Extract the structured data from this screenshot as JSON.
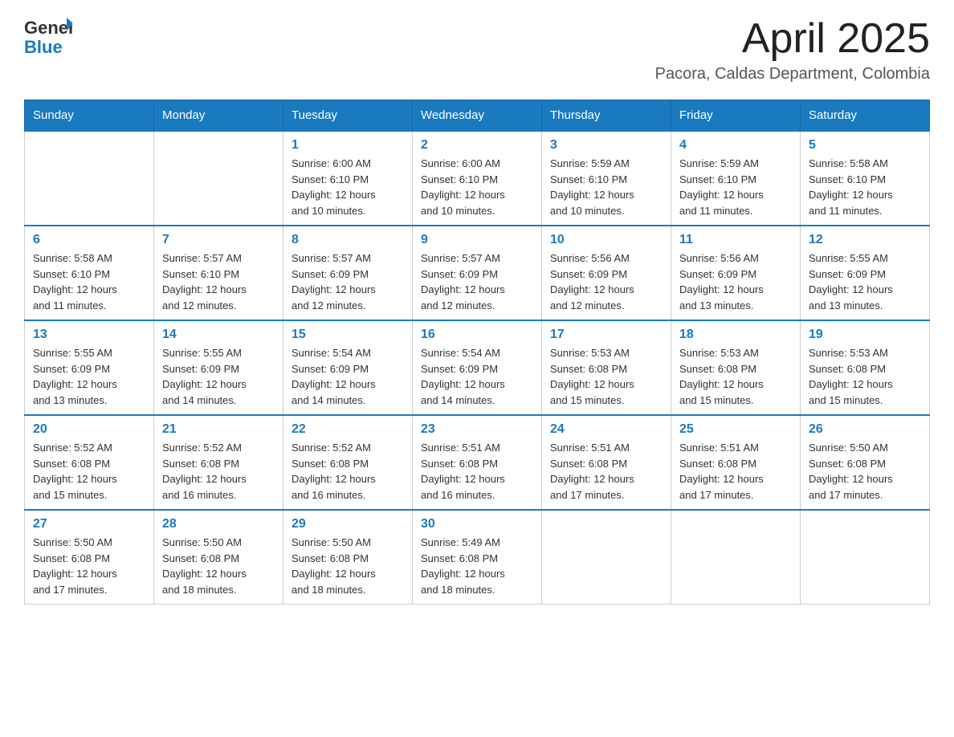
{
  "header": {
    "logo_general": "General",
    "logo_blue": "Blue",
    "month_title": "April 2025",
    "location": "Pacora, Caldas Department, Colombia"
  },
  "weekdays": [
    "Sunday",
    "Monday",
    "Tuesday",
    "Wednesday",
    "Thursday",
    "Friday",
    "Saturday"
  ],
  "weeks": [
    [
      {
        "day": "",
        "info": ""
      },
      {
        "day": "",
        "info": ""
      },
      {
        "day": "1",
        "info": "Sunrise: 6:00 AM\nSunset: 6:10 PM\nDaylight: 12 hours\nand 10 minutes."
      },
      {
        "day": "2",
        "info": "Sunrise: 6:00 AM\nSunset: 6:10 PM\nDaylight: 12 hours\nand 10 minutes."
      },
      {
        "day": "3",
        "info": "Sunrise: 5:59 AM\nSunset: 6:10 PM\nDaylight: 12 hours\nand 10 minutes."
      },
      {
        "day": "4",
        "info": "Sunrise: 5:59 AM\nSunset: 6:10 PM\nDaylight: 12 hours\nand 11 minutes."
      },
      {
        "day": "5",
        "info": "Sunrise: 5:58 AM\nSunset: 6:10 PM\nDaylight: 12 hours\nand 11 minutes."
      }
    ],
    [
      {
        "day": "6",
        "info": "Sunrise: 5:58 AM\nSunset: 6:10 PM\nDaylight: 12 hours\nand 11 minutes."
      },
      {
        "day": "7",
        "info": "Sunrise: 5:57 AM\nSunset: 6:10 PM\nDaylight: 12 hours\nand 12 minutes."
      },
      {
        "day": "8",
        "info": "Sunrise: 5:57 AM\nSunset: 6:09 PM\nDaylight: 12 hours\nand 12 minutes."
      },
      {
        "day": "9",
        "info": "Sunrise: 5:57 AM\nSunset: 6:09 PM\nDaylight: 12 hours\nand 12 minutes."
      },
      {
        "day": "10",
        "info": "Sunrise: 5:56 AM\nSunset: 6:09 PM\nDaylight: 12 hours\nand 12 minutes."
      },
      {
        "day": "11",
        "info": "Sunrise: 5:56 AM\nSunset: 6:09 PM\nDaylight: 12 hours\nand 13 minutes."
      },
      {
        "day": "12",
        "info": "Sunrise: 5:55 AM\nSunset: 6:09 PM\nDaylight: 12 hours\nand 13 minutes."
      }
    ],
    [
      {
        "day": "13",
        "info": "Sunrise: 5:55 AM\nSunset: 6:09 PM\nDaylight: 12 hours\nand 13 minutes."
      },
      {
        "day": "14",
        "info": "Sunrise: 5:55 AM\nSunset: 6:09 PM\nDaylight: 12 hours\nand 14 minutes."
      },
      {
        "day": "15",
        "info": "Sunrise: 5:54 AM\nSunset: 6:09 PM\nDaylight: 12 hours\nand 14 minutes."
      },
      {
        "day": "16",
        "info": "Sunrise: 5:54 AM\nSunset: 6:09 PM\nDaylight: 12 hours\nand 14 minutes."
      },
      {
        "day": "17",
        "info": "Sunrise: 5:53 AM\nSunset: 6:08 PM\nDaylight: 12 hours\nand 15 minutes."
      },
      {
        "day": "18",
        "info": "Sunrise: 5:53 AM\nSunset: 6:08 PM\nDaylight: 12 hours\nand 15 minutes."
      },
      {
        "day": "19",
        "info": "Sunrise: 5:53 AM\nSunset: 6:08 PM\nDaylight: 12 hours\nand 15 minutes."
      }
    ],
    [
      {
        "day": "20",
        "info": "Sunrise: 5:52 AM\nSunset: 6:08 PM\nDaylight: 12 hours\nand 15 minutes."
      },
      {
        "day": "21",
        "info": "Sunrise: 5:52 AM\nSunset: 6:08 PM\nDaylight: 12 hours\nand 16 minutes."
      },
      {
        "day": "22",
        "info": "Sunrise: 5:52 AM\nSunset: 6:08 PM\nDaylight: 12 hours\nand 16 minutes."
      },
      {
        "day": "23",
        "info": "Sunrise: 5:51 AM\nSunset: 6:08 PM\nDaylight: 12 hours\nand 16 minutes."
      },
      {
        "day": "24",
        "info": "Sunrise: 5:51 AM\nSunset: 6:08 PM\nDaylight: 12 hours\nand 17 minutes."
      },
      {
        "day": "25",
        "info": "Sunrise: 5:51 AM\nSunset: 6:08 PM\nDaylight: 12 hours\nand 17 minutes."
      },
      {
        "day": "26",
        "info": "Sunrise: 5:50 AM\nSunset: 6:08 PM\nDaylight: 12 hours\nand 17 minutes."
      }
    ],
    [
      {
        "day": "27",
        "info": "Sunrise: 5:50 AM\nSunset: 6:08 PM\nDaylight: 12 hours\nand 17 minutes."
      },
      {
        "day": "28",
        "info": "Sunrise: 5:50 AM\nSunset: 6:08 PM\nDaylight: 12 hours\nand 18 minutes."
      },
      {
        "day": "29",
        "info": "Sunrise: 5:50 AM\nSunset: 6:08 PM\nDaylight: 12 hours\nand 18 minutes."
      },
      {
        "day": "30",
        "info": "Sunrise: 5:49 AM\nSunset: 6:08 PM\nDaylight: 12 hours\nand 18 minutes."
      },
      {
        "day": "",
        "info": ""
      },
      {
        "day": "",
        "info": ""
      },
      {
        "day": "",
        "info": ""
      }
    ]
  ]
}
